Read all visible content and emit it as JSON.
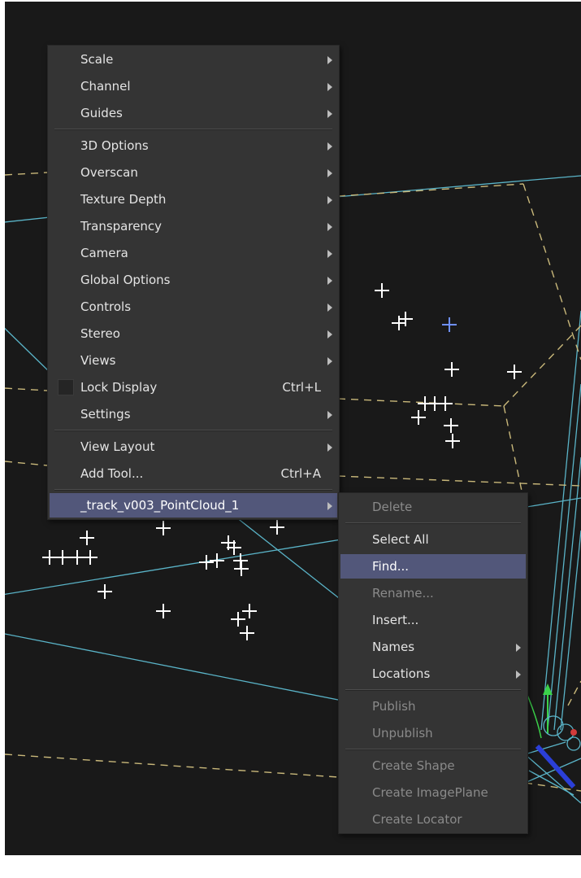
{
  "context_menu": {
    "items": [
      {
        "label": "Scale",
        "submenu": true
      },
      {
        "label": "Channel",
        "submenu": true
      },
      {
        "label": "Guides",
        "submenu": true
      },
      {
        "label": "3D Options",
        "submenu": true
      },
      {
        "label": "Overscan",
        "submenu": true
      },
      {
        "label": "Texture Depth",
        "submenu": true
      },
      {
        "label": "Transparency",
        "submenu": true
      },
      {
        "label": "Camera",
        "submenu": true
      },
      {
        "label": "Global Options",
        "submenu": true
      },
      {
        "label": "Controls",
        "submenu": true
      },
      {
        "label": "Stereo",
        "submenu": true
      },
      {
        "label": "Views",
        "submenu": true
      },
      {
        "label": "Lock Display",
        "shortcut": "Ctrl+L",
        "checkbox": true,
        "checked": false
      },
      {
        "label": "Settings",
        "submenu": true
      },
      {
        "label": "View Layout",
        "submenu": true
      },
      {
        "label": "Add Tool...",
        "shortcut": "Ctrl+A"
      },
      {
        "label": "_track_v003_PointCloud_1",
        "submenu": true,
        "highlighted": true
      }
    ]
  },
  "submenu": {
    "items": [
      {
        "label": "Delete",
        "disabled": true
      },
      {
        "label": "Select All"
      },
      {
        "label": "Find...",
        "highlighted": true
      },
      {
        "label": "Rename...",
        "disabled": true
      },
      {
        "label": "Insert..."
      },
      {
        "label": "Names",
        "submenu": true
      },
      {
        "label": "Locations",
        "submenu": true
      },
      {
        "label": "Publish",
        "disabled": true
      },
      {
        "label": "Unpublish",
        "disabled": true
      },
      {
        "label": "Create Shape",
        "disabled": true
      },
      {
        "label": "Create ImagePlane",
        "disabled": true
      },
      {
        "label": "Create Locator",
        "disabled": true
      }
    ]
  },
  "colors": {
    "viewport_bg": "#191919",
    "menu_bg": "#343434",
    "highlight": "#52577a",
    "wire_cyan": "#5ab4c8",
    "guide_dash": "#c9b87a",
    "point_white": "#ffffff",
    "point_selected": "#6f90ff"
  }
}
